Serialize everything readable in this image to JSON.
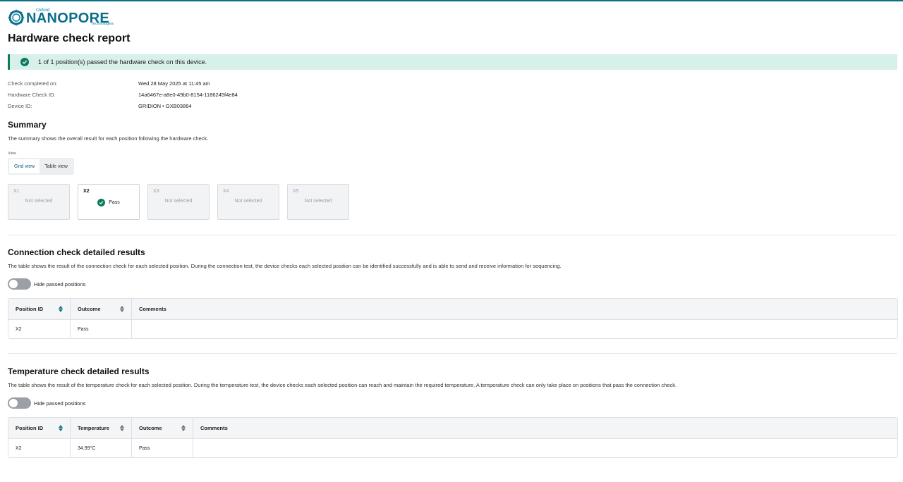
{
  "brand": {
    "oxford": "Oxford",
    "name": "NANOPORE",
    "tech": "Technologies",
    "color": "#0a6e8a"
  },
  "page_title": "Hardware check report",
  "banner": {
    "text": "1 of 1 position(s) passed the hardware check on this device.",
    "icon": "check-circle-icon",
    "color": "#0d7a5f"
  },
  "meta": [
    {
      "label": "Check completed on:",
      "value": "Wed 28 May 2025 at 11:45 am"
    },
    {
      "label": "Hardware Check ID:",
      "value": "14a6467e-a8e0-49b0-8154-1186245f4e84"
    },
    {
      "label": "Device ID:",
      "value": "GRIDION • GXB03864"
    }
  ],
  "summary": {
    "title": "Summary",
    "description": "The summary shows the overall result for each position following the hardware check.",
    "view_label": "View",
    "views": [
      "Grid view",
      "Table view"
    ],
    "active_view": "Grid view",
    "positions": [
      {
        "name": "X1",
        "status": "Not selected",
        "selected": false
      },
      {
        "name": "X2",
        "status": "Pass",
        "selected": true
      },
      {
        "name": "X3",
        "status": "Not selected",
        "selected": false
      },
      {
        "name": "X4",
        "status": "Not selected",
        "selected": false
      },
      {
        "name": "X5",
        "status": "Not selected",
        "selected": false
      }
    ]
  },
  "connection": {
    "title": "Connection check detailed results",
    "description": "The table shows the result of the connection check for each selected position. During the connection test, the device checks each selected position can be identified successfully and is able to send and receive information for sequencing.",
    "toggle_label": "Hide passed positions",
    "toggle_on": false,
    "columns": [
      "Position ID",
      "Outcome",
      "Comments"
    ],
    "rows": [
      [
        "X2",
        "Pass",
        ""
      ]
    ]
  },
  "temperature": {
    "title": "Temperature check detailed results",
    "description": "The table shows the result of the temperature check for each selected position. During the temperature test, the device checks each selected position can reach and maintain the required temperature. A temperature check can only take place on positions that pass the connection check.",
    "toggle_label": "Hide passed positions",
    "toggle_on": false,
    "columns": [
      "Position ID",
      "Temperature",
      "Outcome",
      "Comments"
    ],
    "rows": [
      [
        "X2",
        "34.99°C",
        "Pass",
        ""
      ]
    ]
  }
}
